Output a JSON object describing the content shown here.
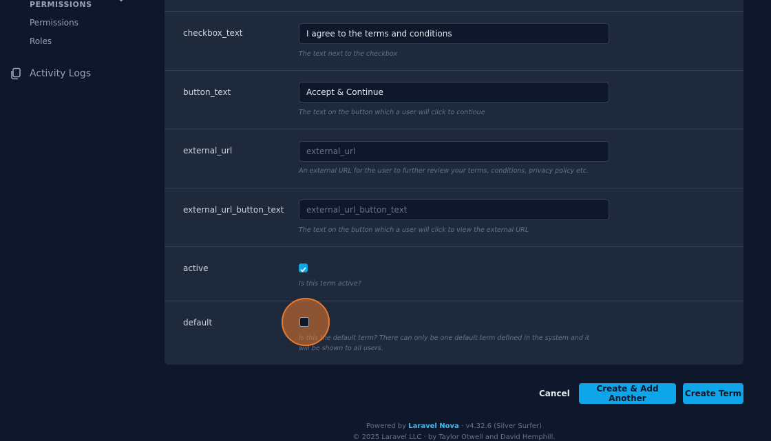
{
  "sidebar": {
    "section_heading": "PERMISSIONS",
    "links": [
      {
        "label": "Permissions"
      },
      {
        "label": "Roles"
      }
    ],
    "activity_logs": "Activity Logs"
  },
  "form": {
    "checkbox_text": {
      "label": "checkbox_text",
      "value": "I agree to the terms and conditions",
      "help": "The text next to the checkbox"
    },
    "button_text": {
      "label": "button_text",
      "value": "Accept & Continue",
      "help": "The text on the button which a user will click to continue"
    },
    "external_url": {
      "label": "external_url",
      "value": "",
      "placeholder": "external_url",
      "help": "An external URL for the user to further review your terms, conditions, privacy policy etc."
    },
    "external_url_button_text": {
      "label": "external_url_button_text",
      "value": "",
      "placeholder": "external_url_button_text",
      "help": "The text on the button which a user will click to view the external URL"
    },
    "active": {
      "label": "active",
      "checked": true,
      "help": "Is this term active?"
    },
    "default": {
      "label": "default",
      "checked": false,
      "help": "Is this the default term? There can only be one default term defined in the system and it will be shown to all users."
    }
  },
  "actions": {
    "cancel": "Cancel",
    "create_another": "Create & Add Another",
    "create": "Create Term"
  },
  "footer": {
    "powered_by": "Powered by",
    "brand": "Laravel Nova",
    "version": "· v4.32.6 (Silver Surfer)",
    "copyright": "© 2025 Laravel LLC · by Taylor Otwell and David Hemphill."
  },
  "colors": {
    "background": "#0f172a",
    "card": "#1e293b",
    "accent": "#0ea5e9",
    "focus_ring": "#ea7a2d"
  }
}
